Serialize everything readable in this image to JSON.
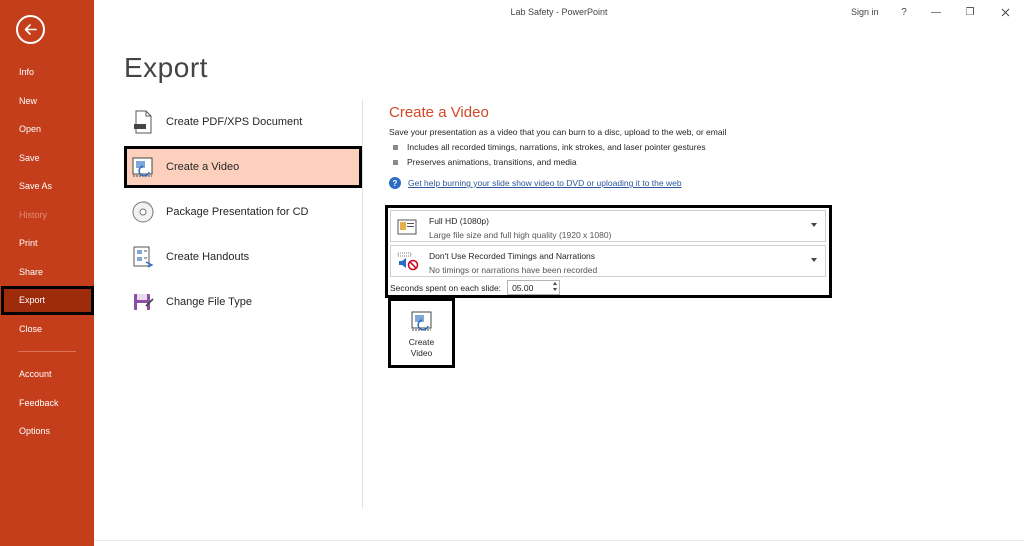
{
  "window": {
    "title": "Lab Safety  -  PowerPoint",
    "sign_in": "Sign in",
    "help": "?",
    "minimize": "—",
    "restore": "❐"
  },
  "sidebar": {
    "items": [
      {
        "label": "Info",
        "state": "normal"
      },
      {
        "label": "New",
        "state": "normal"
      },
      {
        "label": "Open",
        "state": "normal"
      },
      {
        "label": "Save",
        "state": "normal"
      },
      {
        "label": "Save As",
        "state": "normal"
      },
      {
        "label": "History",
        "state": "disabled"
      },
      {
        "label": "Print",
        "state": "normal"
      },
      {
        "label": "Share",
        "state": "normal"
      },
      {
        "label": "Export",
        "state": "active"
      },
      {
        "label": "Close",
        "state": "normal"
      }
    ],
    "bottom_items": [
      {
        "label": "Account"
      },
      {
        "label": "Feedback"
      },
      {
        "label": "Options"
      }
    ]
  },
  "page": {
    "title": "Export"
  },
  "export_options": [
    {
      "label": "Create PDF/XPS Document",
      "icon": "pdf-document-icon",
      "active": false
    },
    {
      "label": "Create a Video",
      "icon": "video-icon",
      "active": true
    },
    {
      "label": "Package Presentation for CD",
      "icon": "cd-icon",
      "active": false
    },
    {
      "label": "Create Handouts",
      "icon": "handouts-icon",
      "active": false
    },
    {
      "label": "Change File Type",
      "icon": "file-type-icon",
      "active": false
    }
  ],
  "detail": {
    "title": "Create a Video",
    "description": "Save your presentation as a video that you can burn to a disc, upload to the web, or email",
    "bullets": [
      "Includes all recorded timings, narrations, ink strokes, and laser pointer gestures",
      "Preserves animations, transitions, and media"
    ],
    "help_link": "Get help burning your slide show video to DVD or uploading it to the web",
    "quality": {
      "title": "Full HD (1080p)",
      "subtitle": "Large file size and full high quality (1920 x 1080)"
    },
    "timings": {
      "title": "Don't Use Recorded Timings and Narrations",
      "subtitle": "No timings or narrations have been recorded"
    },
    "seconds_label": "Seconds spent on each slide:",
    "seconds_value": "05.00",
    "create_button": {
      "line1": "Create",
      "line2": "Video"
    }
  },
  "colors": {
    "sidebar_bg": "#c43e1c",
    "sidebar_active": "#9f2b0d",
    "accent_text": "#d24726",
    "option_active_bg": "#fcd0bd",
    "link": "#2b579a"
  }
}
